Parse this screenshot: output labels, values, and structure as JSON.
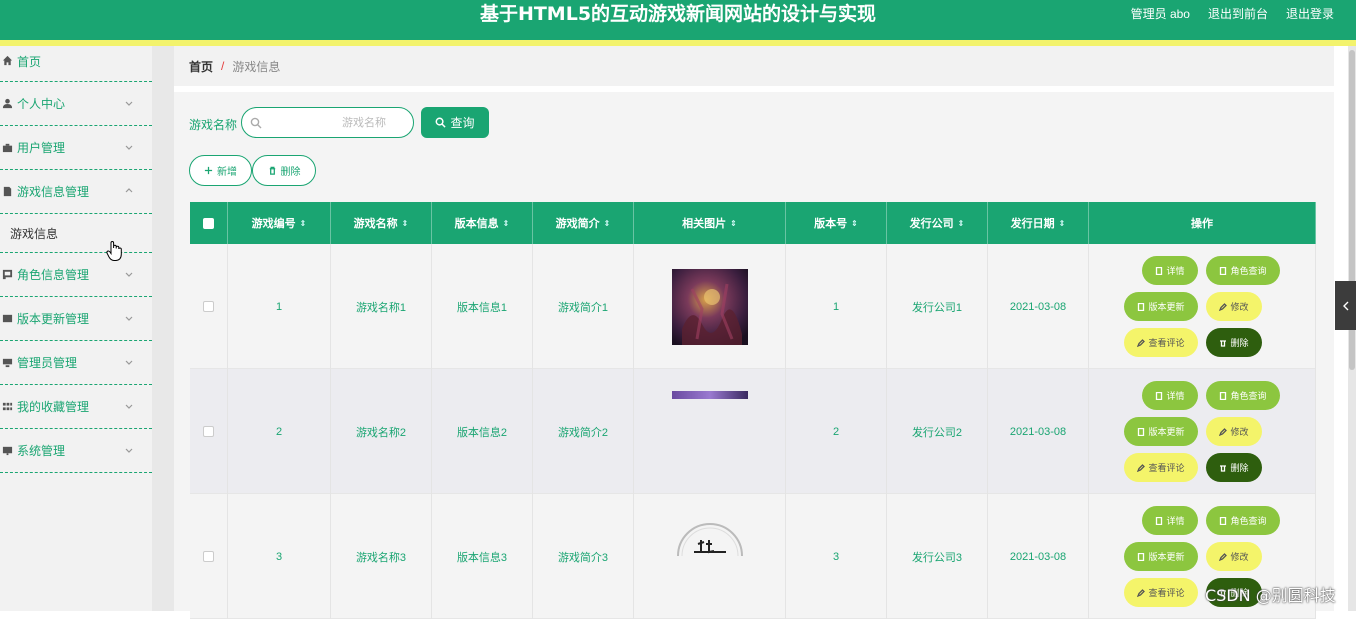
{
  "header": {
    "title": "基于HTML5的互动游戏新闻网站的设计与实现",
    "admin_label": "管理员 abo",
    "front_label": "退出到前台",
    "logout_label": "退出登录"
  },
  "sidebar": {
    "items": [
      {
        "label": "首页",
        "icon": "home-icon"
      },
      {
        "label": "个人中心",
        "icon": "user-icon"
      },
      {
        "label": "用户管理",
        "icon": "briefcase-icon"
      },
      {
        "label": "游戏信息管理",
        "icon": "document-icon"
      },
      {
        "label": "角色信息管理",
        "icon": "frame-icon"
      },
      {
        "label": "版本更新管理",
        "icon": "card-icon"
      },
      {
        "label": "管理员管理",
        "icon": "monitor-icon"
      },
      {
        "label": "我的收藏管理",
        "icon": "grid-icon"
      },
      {
        "label": "系统管理",
        "icon": "desktop-icon"
      }
    ],
    "submenu": {
      "label": "游戏信息"
    }
  },
  "breadcrumb": {
    "home": "首页",
    "separator": "/",
    "current": "游戏信息"
  },
  "search": {
    "label": "游戏名称",
    "placeholder": "游戏名称",
    "query_label": "查询"
  },
  "actions": {
    "add_label": "新增",
    "delete_label": "删除"
  },
  "table": {
    "columns": [
      "游戏编号",
      "游戏名称",
      "版本信息",
      "游戏简介",
      "相关图片",
      "版本号",
      "发行公司",
      "发行日期",
      "操作"
    ],
    "rows": [
      {
        "id": "1",
        "name": "游戏名称1",
        "version_info": "版本信息1",
        "intro": "游戏简介1",
        "version_no": "1",
        "company": "发行公司1",
        "date": "2021-03-08"
      },
      {
        "id": "2",
        "name": "游戏名称2",
        "version_info": "版本信息2",
        "intro": "游戏简介2",
        "version_no": "2",
        "company": "发行公司2",
        "date": "2021-03-08"
      },
      {
        "id": "3",
        "name": "游戏名称3",
        "version_info": "版本信息3",
        "intro": "游戏简介3",
        "version_no": "3",
        "company": "发行公司3",
        "date": "2021-03-08"
      }
    ],
    "row_actions": {
      "detail": "详情",
      "role_query": "角色查询",
      "version_update": "版本更新",
      "edit": "修改",
      "view_comments": "查看评论",
      "delete": "删除"
    }
  },
  "watermark": "CSDN @别圆科技",
  "colors": {
    "primary": "#1aa572",
    "accent_bar": "#f3f36d",
    "btn_green": "#8cc63f",
    "btn_yellow": "#f4f46a",
    "btn_dark": "#2e5e0e"
  }
}
